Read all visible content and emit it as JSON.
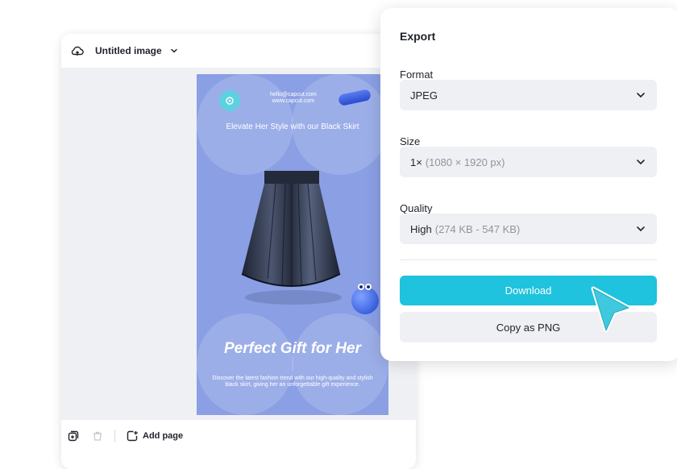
{
  "editor": {
    "title": "Untitled image",
    "bottom_bar": {
      "add_page_label": "Add page"
    }
  },
  "poster": {
    "contact_email": "hello@capcut.com",
    "contact_site": "www.capcut.com",
    "heading": "Elevate Her Style with our Black Skirt",
    "tagline": "Perfect Gift for Her",
    "description": "Discover the latest fashion trend with our high-quality and stylish black skirt, giving her an unforgettable gift experience.",
    "background_color": "#8a9fe4"
  },
  "export_panel": {
    "title": "Export",
    "format": {
      "label": "Format",
      "value": "JPEG"
    },
    "size": {
      "label": "Size",
      "value": "1×",
      "detail": "(1080 × 1920 px)"
    },
    "quality": {
      "label": "Quality",
      "value": "High",
      "detail": "(274 KB - 547 KB)"
    },
    "download_label": "Download",
    "copy_label": "Copy as PNG",
    "accent_color": "#1fc3dd"
  }
}
